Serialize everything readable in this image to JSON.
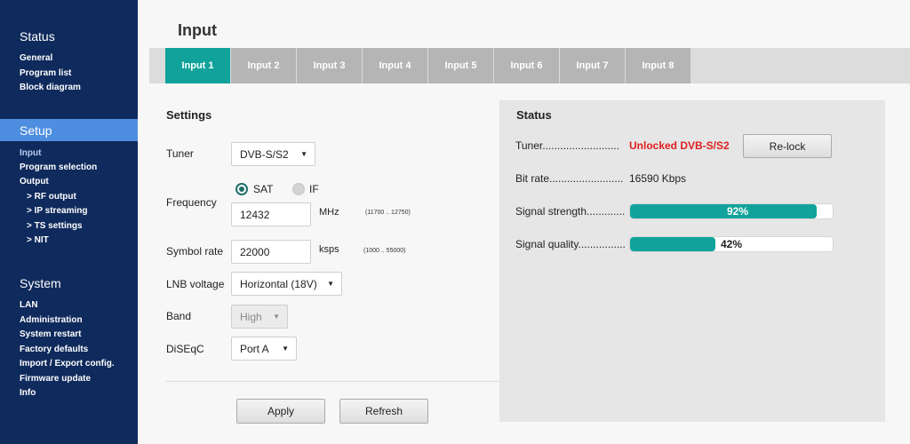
{
  "sidebar": {
    "status_heading": "Status",
    "status_items": [
      "General",
      "Program list",
      "Block diagram"
    ],
    "setup_heading": "Setup",
    "setup_items": [
      "Input",
      "Program selection",
      "Output"
    ],
    "output_items": [
      "> RF output",
      "> IP streaming",
      "> TS settings",
      "> NIT"
    ],
    "system_heading": "System",
    "system_items": [
      "LAN",
      "Administration",
      "System restart",
      "Factory defaults",
      "Import / Export config.",
      "Firmware update",
      "Info"
    ],
    "active_item": "Input"
  },
  "page": {
    "title": "Input"
  },
  "tabs": [
    "Input 1",
    "Input 2",
    "Input 3",
    "Input 4",
    "Input 5",
    "Input 6",
    "Input 7",
    "Input 8"
  ],
  "active_tab": "Input 1",
  "settings": {
    "title": "Settings",
    "tuner_label": "Tuner",
    "tuner_value": "DVB-S/S2",
    "frequency_label": "Frequency",
    "radio_sat": "SAT",
    "radio_if": "IF",
    "frequency_value": "12432",
    "frequency_unit": "MHz",
    "frequency_range": "(11700 .. 12750)",
    "symbol_rate_label": "Symbol rate",
    "symbol_rate_value": "22000",
    "symbol_rate_unit": "ksps",
    "symbol_rate_range": "(1000 .. 55000)",
    "lnb_label": "LNB voltage",
    "lnb_value": "Horizontal (18V)",
    "band_label": "Band",
    "band_value": "High",
    "diseqc_label": "DiSEqC",
    "diseqc_value": "Port A",
    "apply_label": "Apply",
    "refresh_label": "Refresh"
  },
  "status": {
    "title": "Status",
    "tuner_label": "Tuner..........................",
    "tuner_value": "Unlocked DVB-S/S2",
    "relock_label": "Re-lock",
    "bitrate_label": "Bit rate.........................",
    "bitrate_value": "16590 Kbps",
    "strength_label": "Signal strength.............",
    "strength_text": "92%",
    "strength_percent": 92,
    "quality_label": "Signal quality................",
    "quality_text": "42%",
    "quality_percent": 42
  },
  "colors": {
    "accent": "#11a39b",
    "sidebar": "#0f2a5c",
    "sidebar_active_band": "#4e8ee0",
    "alert": "#e02020"
  },
  "icons": {
    "dropdown": "caret-down-icon",
    "radio_selected": "radio-selected-icon",
    "radio_unselected": "radio-unselected-icon"
  }
}
